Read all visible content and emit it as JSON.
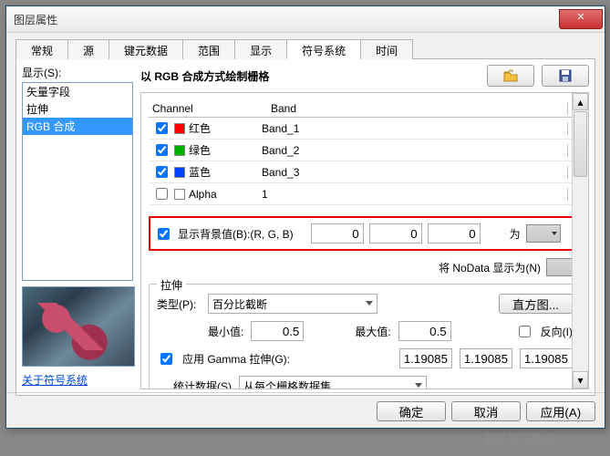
{
  "window": {
    "title": "图层属性"
  },
  "tabs": {
    "items": [
      "常规",
      "源",
      "键元数据",
      "范围",
      "显示",
      "符号系统",
      "时间"
    ],
    "active_index": 5
  },
  "sidebar": {
    "label": "显示(S):",
    "items": [
      "矢量字段",
      "拉伸",
      "RGB 合成"
    ],
    "selected_index": 2,
    "link": "关于符号系统"
  },
  "header": {
    "title": "以 RGB 合成方式绘制栅格"
  },
  "grid": {
    "col1": "Channel",
    "col2": "Band",
    "rows": [
      {
        "checked": true,
        "color": "#ff0000",
        "name": "红色",
        "band": "Band_1"
      },
      {
        "checked": true,
        "color": "#00b000",
        "name": "绿色",
        "band": "Band_2"
      },
      {
        "checked": true,
        "color": "#0040ff",
        "name": "蓝色",
        "band": "Band_3"
      },
      {
        "checked": false,
        "color": "#ffffff",
        "name": "Alpha",
        "band": "1"
      }
    ]
  },
  "background": {
    "checked": true,
    "label": "显示背景值(B):(R, G, B)",
    "r": "0",
    "g": "0",
    "b": "0",
    "as_label": "为"
  },
  "nodata": {
    "label": "将 NoData 显示为(N)"
  },
  "stretch": {
    "legend": "拉伸",
    "type_label": "类型(P):",
    "type_value": "百分比截断",
    "hist_btn": "直方图...",
    "min_label": "最小值:",
    "min": "0.5",
    "max_label": "最大值:",
    "max": "0.5",
    "invert": "反向(I)",
    "gamma_checked": true,
    "gamma_label": "应用 Gamma 拉伸(G):",
    "gamma": [
      "1.19085",
      "1.19085",
      "1.19085"
    ],
    "stats_label": "统计数据(S)",
    "stats_value": "从每个栅格数据集"
  },
  "footer": {
    "ok": "确定",
    "cancel": "取消",
    "apply": "应用(A)"
  }
}
